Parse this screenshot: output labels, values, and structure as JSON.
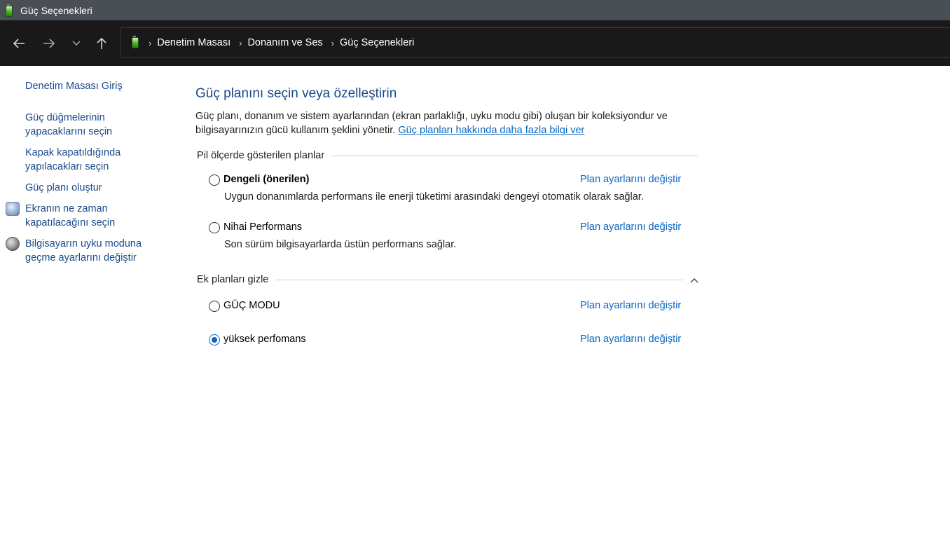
{
  "window": {
    "title": "Güç Seçenekleri"
  },
  "navigation": {
    "breadcrumbs": [
      "Denetim Masası",
      "Donanım ve Ses",
      "Güç Seçenekleri"
    ]
  },
  "sidebar": {
    "items": [
      {
        "label": "Denetim Masası Giriş"
      },
      {
        "label": "Güç düğmelerinin yapacaklarını seçin"
      },
      {
        "label": "Kapak kapatıldığında yapılacakları seçin"
      },
      {
        "label": "Güç planı oluştur"
      },
      {
        "label": "Ekranın ne zaman kapatılacağını seçin"
      },
      {
        "label": "Bilgisayarın uyku moduna geçme ayarlarını değiştir"
      }
    ]
  },
  "main": {
    "title": "Güç planını seçin veya özelleştirin",
    "description": "Güç planı, donanım ve sistem ayarlarından (ekran parlaklığı, uyku modu gibi) oluşan bir koleksiyondur ve bilgisayarınızın gücü kullanım şeklini yönetir.",
    "description_link": "Güç planları hakkında daha fazla bilgi ver",
    "group1_title": "Pil ölçerde gösterilen planlar",
    "group2_title": "Ek planları gizle",
    "plans": [
      {
        "name": "Dengeli (önerilen)",
        "description": "Uygun donanımlarda performans ile enerji tüketimi arasındaki dengeyi otomatik olarak sağlar.",
        "link": "Plan ayarlarını değiştir",
        "selected": false
      },
      {
        "name": "Nihai Performans",
        "description": "Son sürüm bilgisayarlarda üstün performans sağlar.",
        "link": "Plan ayarlarını değiştir",
        "selected": false
      },
      {
        "name": "GÜÇ MODU",
        "description": "",
        "link": "Plan ayarlarını değiştir",
        "selected": false
      },
      {
        "name": "yüksek perfomans",
        "description": "",
        "link": "Plan ayarlarını değiştir",
        "selected": true
      }
    ]
  },
  "colors": {
    "link": "#0a66c2",
    "sidebar_link": "#1a4a8a",
    "title_bar": "#4a4f55",
    "address_bar": "#191919"
  },
  "icons": {
    "app": "battery-icon",
    "back": "arrow-left-icon",
    "forward": "arrow-right-icon",
    "recent": "chevron-down-icon",
    "up": "arrow-up-icon",
    "collapse": "chevron-up-icon"
  }
}
